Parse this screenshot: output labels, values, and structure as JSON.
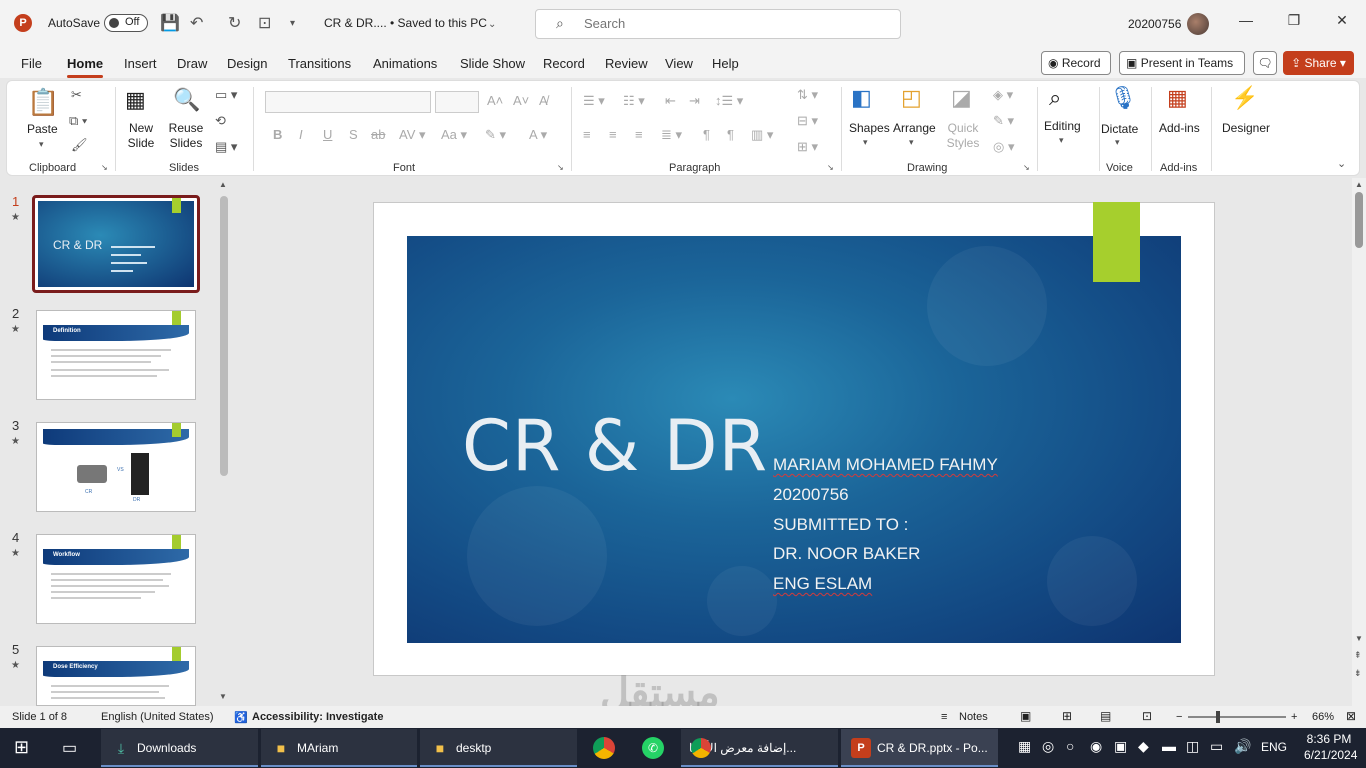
{
  "titlebar": {
    "autosave_label": "AutoSave",
    "autosave_state": "Off",
    "doc_title": "CR & DR....  •  Saved to this PC",
    "search_placeholder": "Search",
    "user_id": "20200756"
  },
  "menu": {
    "tabs": [
      "File",
      "Home",
      "Insert",
      "Draw",
      "Design",
      "Transitions",
      "Animations",
      "Slide Show",
      "Record",
      "Review",
      "View",
      "Help"
    ],
    "active": "Home",
    "record_btn": "Record",
    "teams_btn": "Present in Teams",
    "share_btn": "Share"
  },
  "ribbon": {
    "paste": "Paste",
    "new_slide": "New Slide",
    "reuse_slides": "Reuse Slides",
    "shapes": "Shapes",
    "arrange": "Arrange",
    "quick_styles": "Quick Styles",
    "editing": "Editing",
    "dictate": "Dictate",
    "addins": "Add-ins",
    "designer": "Designer",
    "groups": {
      "clipboard": "Clipboard",
      "slides": "Slides",
      "font": "Font",
      "paragraph": "Paragraph",
      "drawing": "Drawing",
      "voice": "Voice",
      "addins": "Add-ins"
    }
  },
  "thumbnails": [
    {
      "num": "1",
      "title": "CR & DR"
    },
    {
      "num": "2",
      "title": "Definition"
    },
    {
      "num": "3",
      "cr": "CR",
      "vs": "VS",
      "dr": "DR"
    },
    {
      "num": "4",
      "title": "Workflow"
    },
    {
      "num": "5",
      "title": "Dose Efficiency"
    }
  ],
  "slide": {
    "title": "CR & DR",
    "lines": [
      "MARIAM MOHAMED FAHMY",
      "20200756",
      "SUBMITTED TO :",
      "DR. NOOR BAKER",
      "ENG ESLAM"
    ]
  },
  "status": {
    "slide_of": "Slide 1 of 8",
    "language": "English (United States)",
    "accessibility": "Accessibility: Investigate",
    "notes": "Notes",
    "zoom": "66%"
  },
  "taskbar": {
    "items": [
      "Downloads",
      "MAriam",
      "desktp",
      "...إضافة معرض الأعما",
      "CR & DR.pptx - Po..."
    ],
    "lang": "ENG",
    "time": "8:36 PM",
    "date": "6/21/2024"
  },
  "watermark": "مستقل"
}
